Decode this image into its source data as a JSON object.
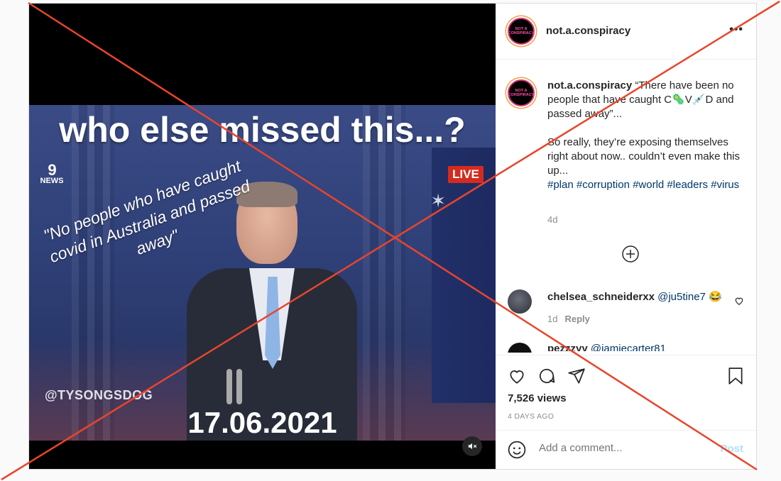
{
  "video": {
    "headline": "who else missed this...?",
    "channel_logo_top": "9",
    "channel_logo_bottom": "NEWS",
    "live_badge": "LIVE",
    "quote": "\"No people who have caught covid in Australia and passed away\"",
    "watermark": "@TYSONGSDOG",
    "date": "17.06.2021"
  },
  "header": {
    "avatar_text": "NOT A CONSPIRACY",
    "username": "not.a.conspiracy",
    "more": "•••"
  },
  "caption": {
    "username": "not.a.conspiracy",
    "line1": "“There have been no people that have caught C🦠V💉D and passed away”...",
    "line2": "So really, they’re exposing themselves right about now.. couldn’t even make this up...",
    "hashtags": "#plan #corruption #world #leaders #virus",
    "age": "4d"
  },
  "comments": [
    {
      "username": "chelsea_schneiderxx",
      "mention": "@ju5tine7",
      "emoji": "😂",
      "time": "1d",
      "reply": "Reply"
    },
    {
      "username": "pezzzyy",
      "mention": "@jamiecarter81"
    }
  ],
  "stats": {
    "views": "7,526 views",
    "posted": "4 DAYS AGO"
  },
  "composer": {
    "placeholder": "Add a comment...",
    "post_label": "Post"
  },
  "colors": {
    "overlay_x": "#e8452c",
    "link": "#00376b",
    "post_disabled": "#b2dffc",
    "live": "#d52b1e"
  }
}
